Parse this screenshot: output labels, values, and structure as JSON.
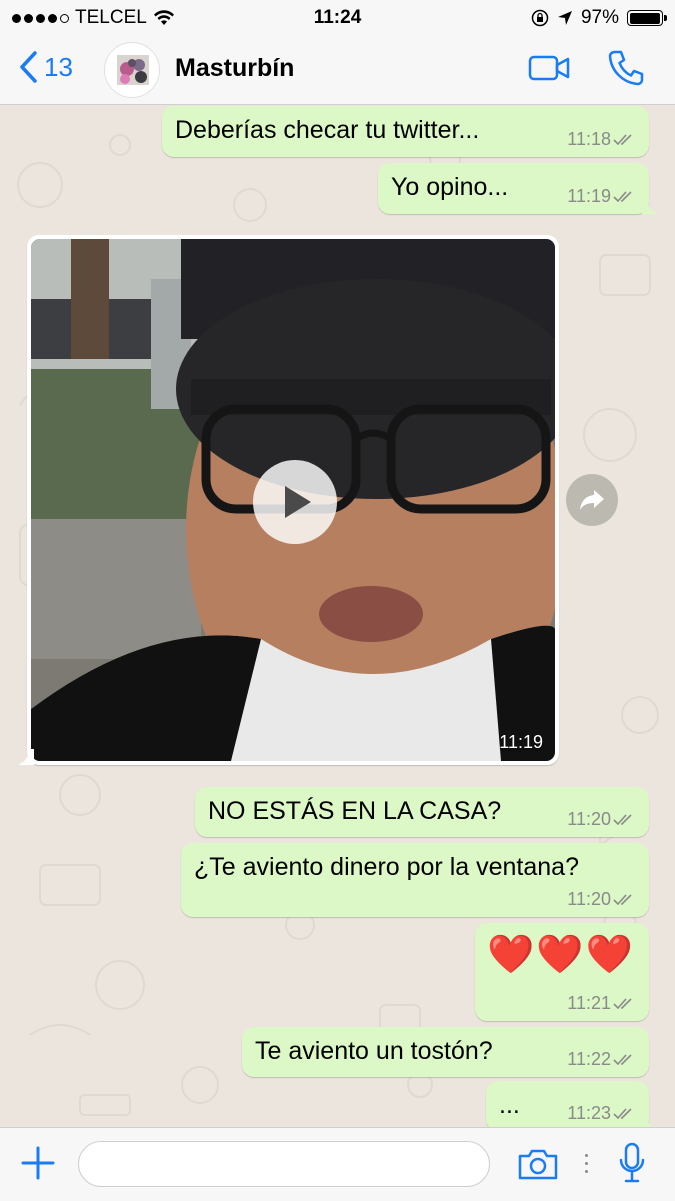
{
  "status_bar": {
    "carrier": "TELCEL",
    "time": "11:24",
    "battery_percent": "97%",
    "battery_level": 0.97,
    "signal_bars": 4,
    "signal_max": 5
  },
  "nav": {
    "back_count": "13",
    "contact_name": "Masturbín",
    "accent_color": "#1a7cf3"
  },
  "messages": [
    {
      "text": "Deberías checar tu twitter...",
      "time": "11:18"
    },
    {
      "text": "Yo opino...",
      "time": "11:19"
    },
    {
      "type": "video",
      "time": "11:19"
    },
    {
      "text": "NO ESTÁS EN LA CASA?",
      "time": "11:20"
    },
    {
      "text": "¿Te aviento dinero por la ventana?",
      "time": "11:20"
    },
    {
      "text": "❤️❤️❤️",
      "time": "11:21"
    },
    {
      "text": "Te aviento un tostón?",
      "time": "11:22"
    },
    {
      "text": "...",
      "time": "11:23"
    }
  ],
  "input_bar": {
    "placeholder": "",
    "icons": [
      "plus-icon",
      "camera-icon",
      "microphone-icon"
    ]
  },
  "colors": {
    "bubble_out": "#dcf8c6",
    "chat_background": "#ece5dd",
    "timestamp": "#8a8a8a"
  }
}
